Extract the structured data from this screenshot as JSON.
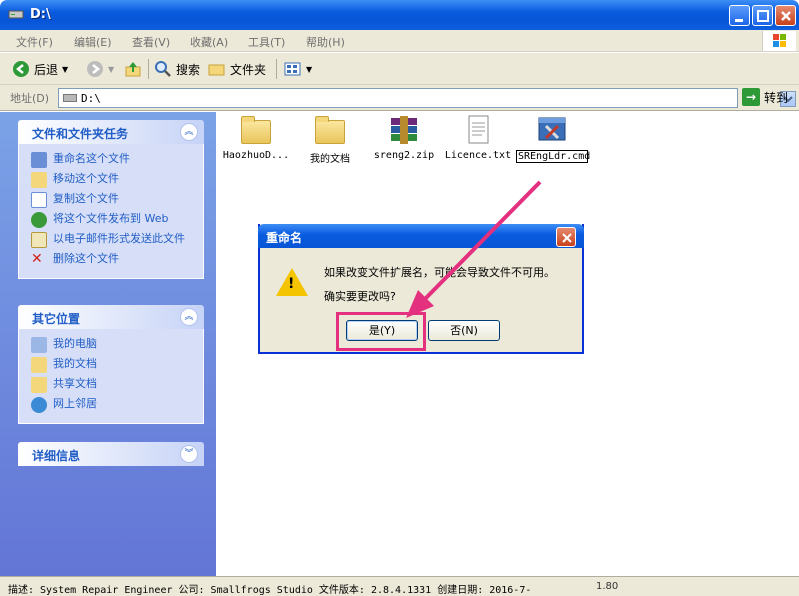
{
  "window": {
    "title": "D:\\",
    "controls": {
      "min": "minimize",
      "max": "maximize",
      "close": "close"
    }
  },
  "menu": [
    "文件(F)",
    "编辑(E)",
    "查看(V)",
    "收藏(A)",
    "工具(T)",
    "帮助(H)"
  ],
  "toolbar": {
    "back": "后退",
    "search": "搜索",
    "folders": "文件夹"
  },
  "address": {
    "label": "地址(D)",
    "value": "D:\\",
    "go": "转到"
  },
  "tasks": {
    "title": "文件和文件夹任务",
    "items": [
      "重命名这个文件",
      "移动这个文件",
      "复制这个文件",
      "将这个文件发布到 Web",
      "以电子邮件形式发送此文件",
      "删除这个文件"
    ]
  },
  "places": {
    "title": "其它位置",
    "items": [
      "我的电脑",
      "我的文档",
      "共享文档",
      "网上邻居"
    ]
  },
  "details": {
    "title": "详细信息"
  },
  "files": [
    {
      "name": "HaozhuoD...",
      "icon": "folder-icon"
    },
    {
      "name": "我的文档",
      "icon": "folder-icon"
    },
    {
      "name": "sreng2.zip",
      "icon": "winrar-archive-icon"
    },
    {
      "name": "Licence.txt",
      "icon": "text-file-icon"
    },
    {
      "name": "SREngLdr.cmd",
      "icon": "tools-icon"
    }
  ],
  "dialog": {
    "title": "重命名",
    "message1": "如果改变文件扩展名，可能会导致文件不可用。",
    "message2": "确实要更改吗?",
    "yes": "是(Y)",
    "no": "否(N)"
  },
  "status": {
    "text": "描述: System Repair Engineer 公司: Smallfrogs Studio 文件版本: 2.8.4.1331 创建日期: 2016-7-",
    "size": "1.80"
  },
  "colors": {
    "accent": "#0a5bdf",
    "highlight": "#e3307f",
    "panel": "#7ba2e7"
  }
}
